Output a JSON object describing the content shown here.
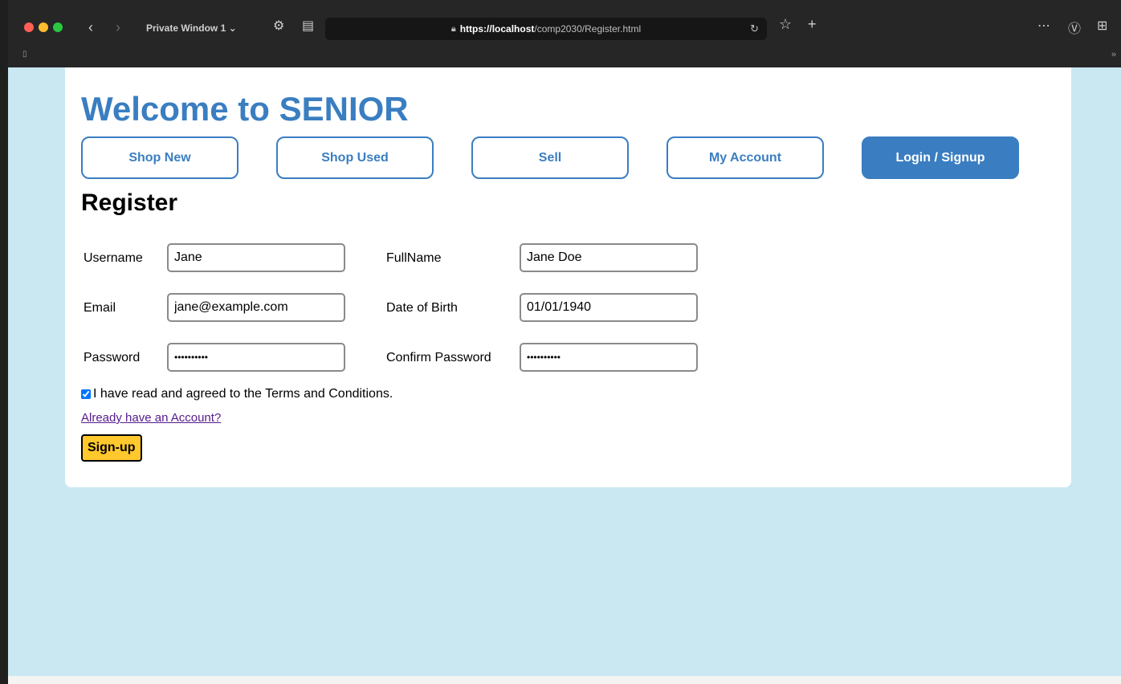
{
  "browser": {
    "window_label": "Private Window 1 ⌄",
    "url_host": "https://localhost",
    "url_path": "/comp2030/Register.html",
    "icons": [
      "back-icon",
      "forward-icon",
      "tracking-shield-icon",
      "reader-icon",
      "lock-icon",
      "reload-icon",
      "star-icon",
      "new-tab-icon",
      "more-icon",
      "downloads-icon",
      "extensions-icon",
      "bookmark-icon",
      "overflow-chevron-icon"
    ]
  },
  "site": {
    "title": "Welcome to SENIOR",
    "nav": [
      {
        "label": "Shop New",
        "active": false
      },
      {
        "label": "Shop Used",
        "active": false
      },
      {
        "label": "Sell",
        "active": false
      },
      {
        "label": "My Account",
        "active": false
      },
      {
        "label": "Login / Signup",
        "active": true
      }
    ]
  },
  "form": {
    "heading": "Register",
    "username": {
      "label": "Username",
      "value": "Jane"
    },
    "fullname": {
      "label": "FullName",
      "value": "Jane Doe"
    },
    "email": {
      "label": "Email",
      "value": "jane@example.com"
    },
    "dob": {
      "label": "Date of Birth",
      "value": "01/01/1940"
    },
    "password": {
      "label": "Password",
      "value": "••••••••••"
    },
    "confirm_password": {
      "label": "Confirm Password",
      "value": "••••••••••"
    },
    "terms_text": "I have read and agreed to the Terms and Conditions.",
    "terms_checked": true,
    "login_link": "Already have an Account?",
    "submit_label": "Sign-up"
  },
  "colors": {
    "brand_blue": "#3a7ec1",
    "page_background": "#c9e8f2",
    "submit_yellow": "#ffc82c",
    "visited_link": "#551a8b"
  }
}
